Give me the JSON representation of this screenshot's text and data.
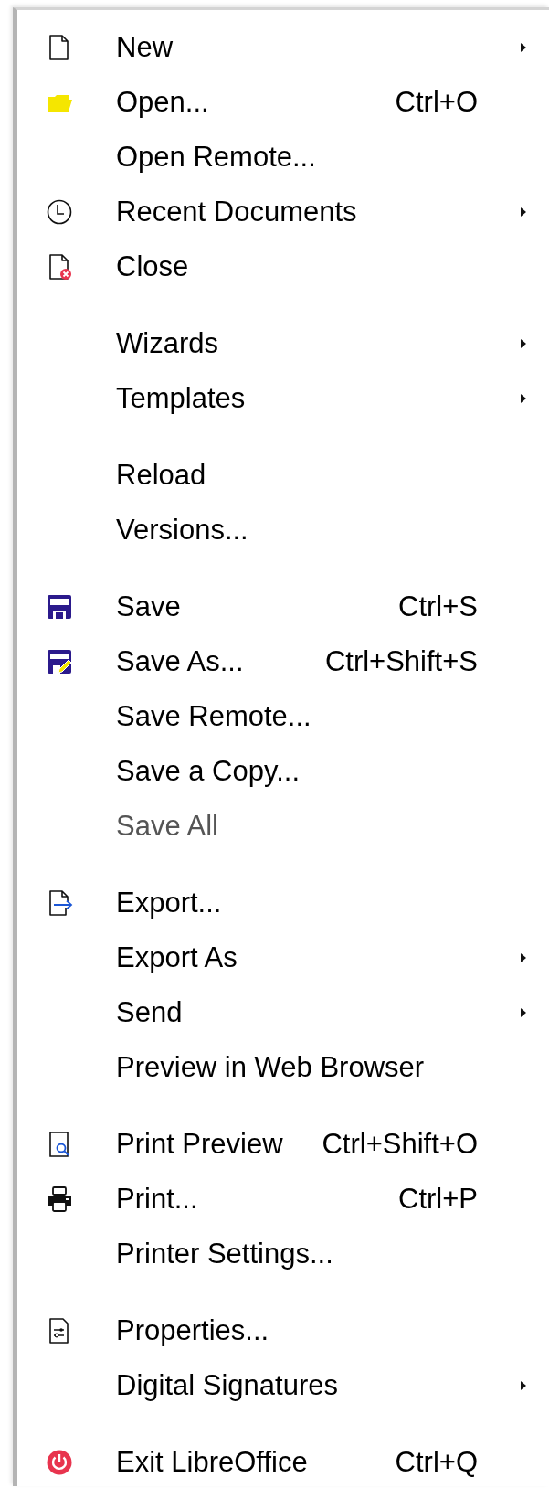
{
  "menu": {
    "groups": [
      {
        "items": [
          {
            "kind": "document",
            "label": "New",
            "submenu": true,
            "disabled": false
          },
          {
            "kind": "folder",
            "label": "Open...",
            "shortcut": "Ctrl+O",
            "submenu": false,
            "disabled": false
          },
          {
            "label": "Open Remote...",
            "submenu": false,
            "disabled": false
          },
          {
            "kind": "clock",
            "label": "Recent Documents",
            "submenu": true,
            "disabled": false
          },
          {
            "kind": "document-x",
            "label": "Close",
            "submenu": false,
            "disabled": false
          }
        ]
      },
      {
        "items": [
          {
            "label": "Wizards",
            "submenu": true,
            "disabled": false
          },
          {
            "label": "Templates",
            "submenu": true,
            "disabled": false
          }
        ]
      },
      {
        "items": [
          {
            "label": "Reload",
            "submenu": false,
            "disabled": false
          },
          {
            "label": "Versions...",
            "submenu": false,
            "disabled": false
          }
        ]
      },
      {
        "items": [
          {
            "kind": "floppy",
            "label": "Save",
            "shortcut": "Ctrl+S",
            "submenu": false,
            "disabled": false
          },
          {
            "kind": "floppy-pencil",
            "label": "Save As...",
            "shortcut": "Ctrl+Shift+S",
            "submenu": false,
            "disabled": false
          },
          {
            "label": "Save Remote...",
            "submenu": false,
            "disabled": false
          },
          {
            "label": "Save a Copy...",
            "submenu": false,
            "disabled": false
          },
          {
            "label": "Save All",
            "submenu": false,
            "disabled": true
          }
        ]
      },
      {
        "items": [
          {
            "kind": "document-arrow",
            "label": "Export...",
            "submenu": false,
            "disabled": false
          },
          {
            "label": "Export As",
            "submenu": true,
            "disabled": false
          },
          {
            "label": "Send",
            "submenu": true,
            "disabled": false
          },
          {
            "label": "Preview in Web Browser",
            "submenu": false,
            "disabled": false
          }
        ]
      },
      {
        "items": [
          {
            "kind": "document-magnifier",
            "label": "Print Preview",
            "shortcut": "Ctrl+Shift+O",
            "submenu": false,
            "disabled": false
          },
          {
            "kind": "printer",
            "label": "Print...",
            "shortcut": "Ctrl+P",
            "submenu": false,
            "disabled": false
          },
          {
            "label": "Printer Settings...",
            "submenu": false,
            "disabled": false
          }
        ]
      },
      {
        "items": [
          {
            "kind": "document-sliders",
            "label": "Properties...",
            "submenu": false,
            "disabled": false
          },
          {
            "label": "Digital Signatures",
            "submenu": true,
            "disabled": false
          }
        ]
      },
      {
        "items": [
          {
            "kind": "power",
            "label": "Exit LibreOffice",
            "shortcut": "Ctrl+Q",
            "submenu": false,
            "disabled": false
          }
        ]
      }
    ]
  }
}
